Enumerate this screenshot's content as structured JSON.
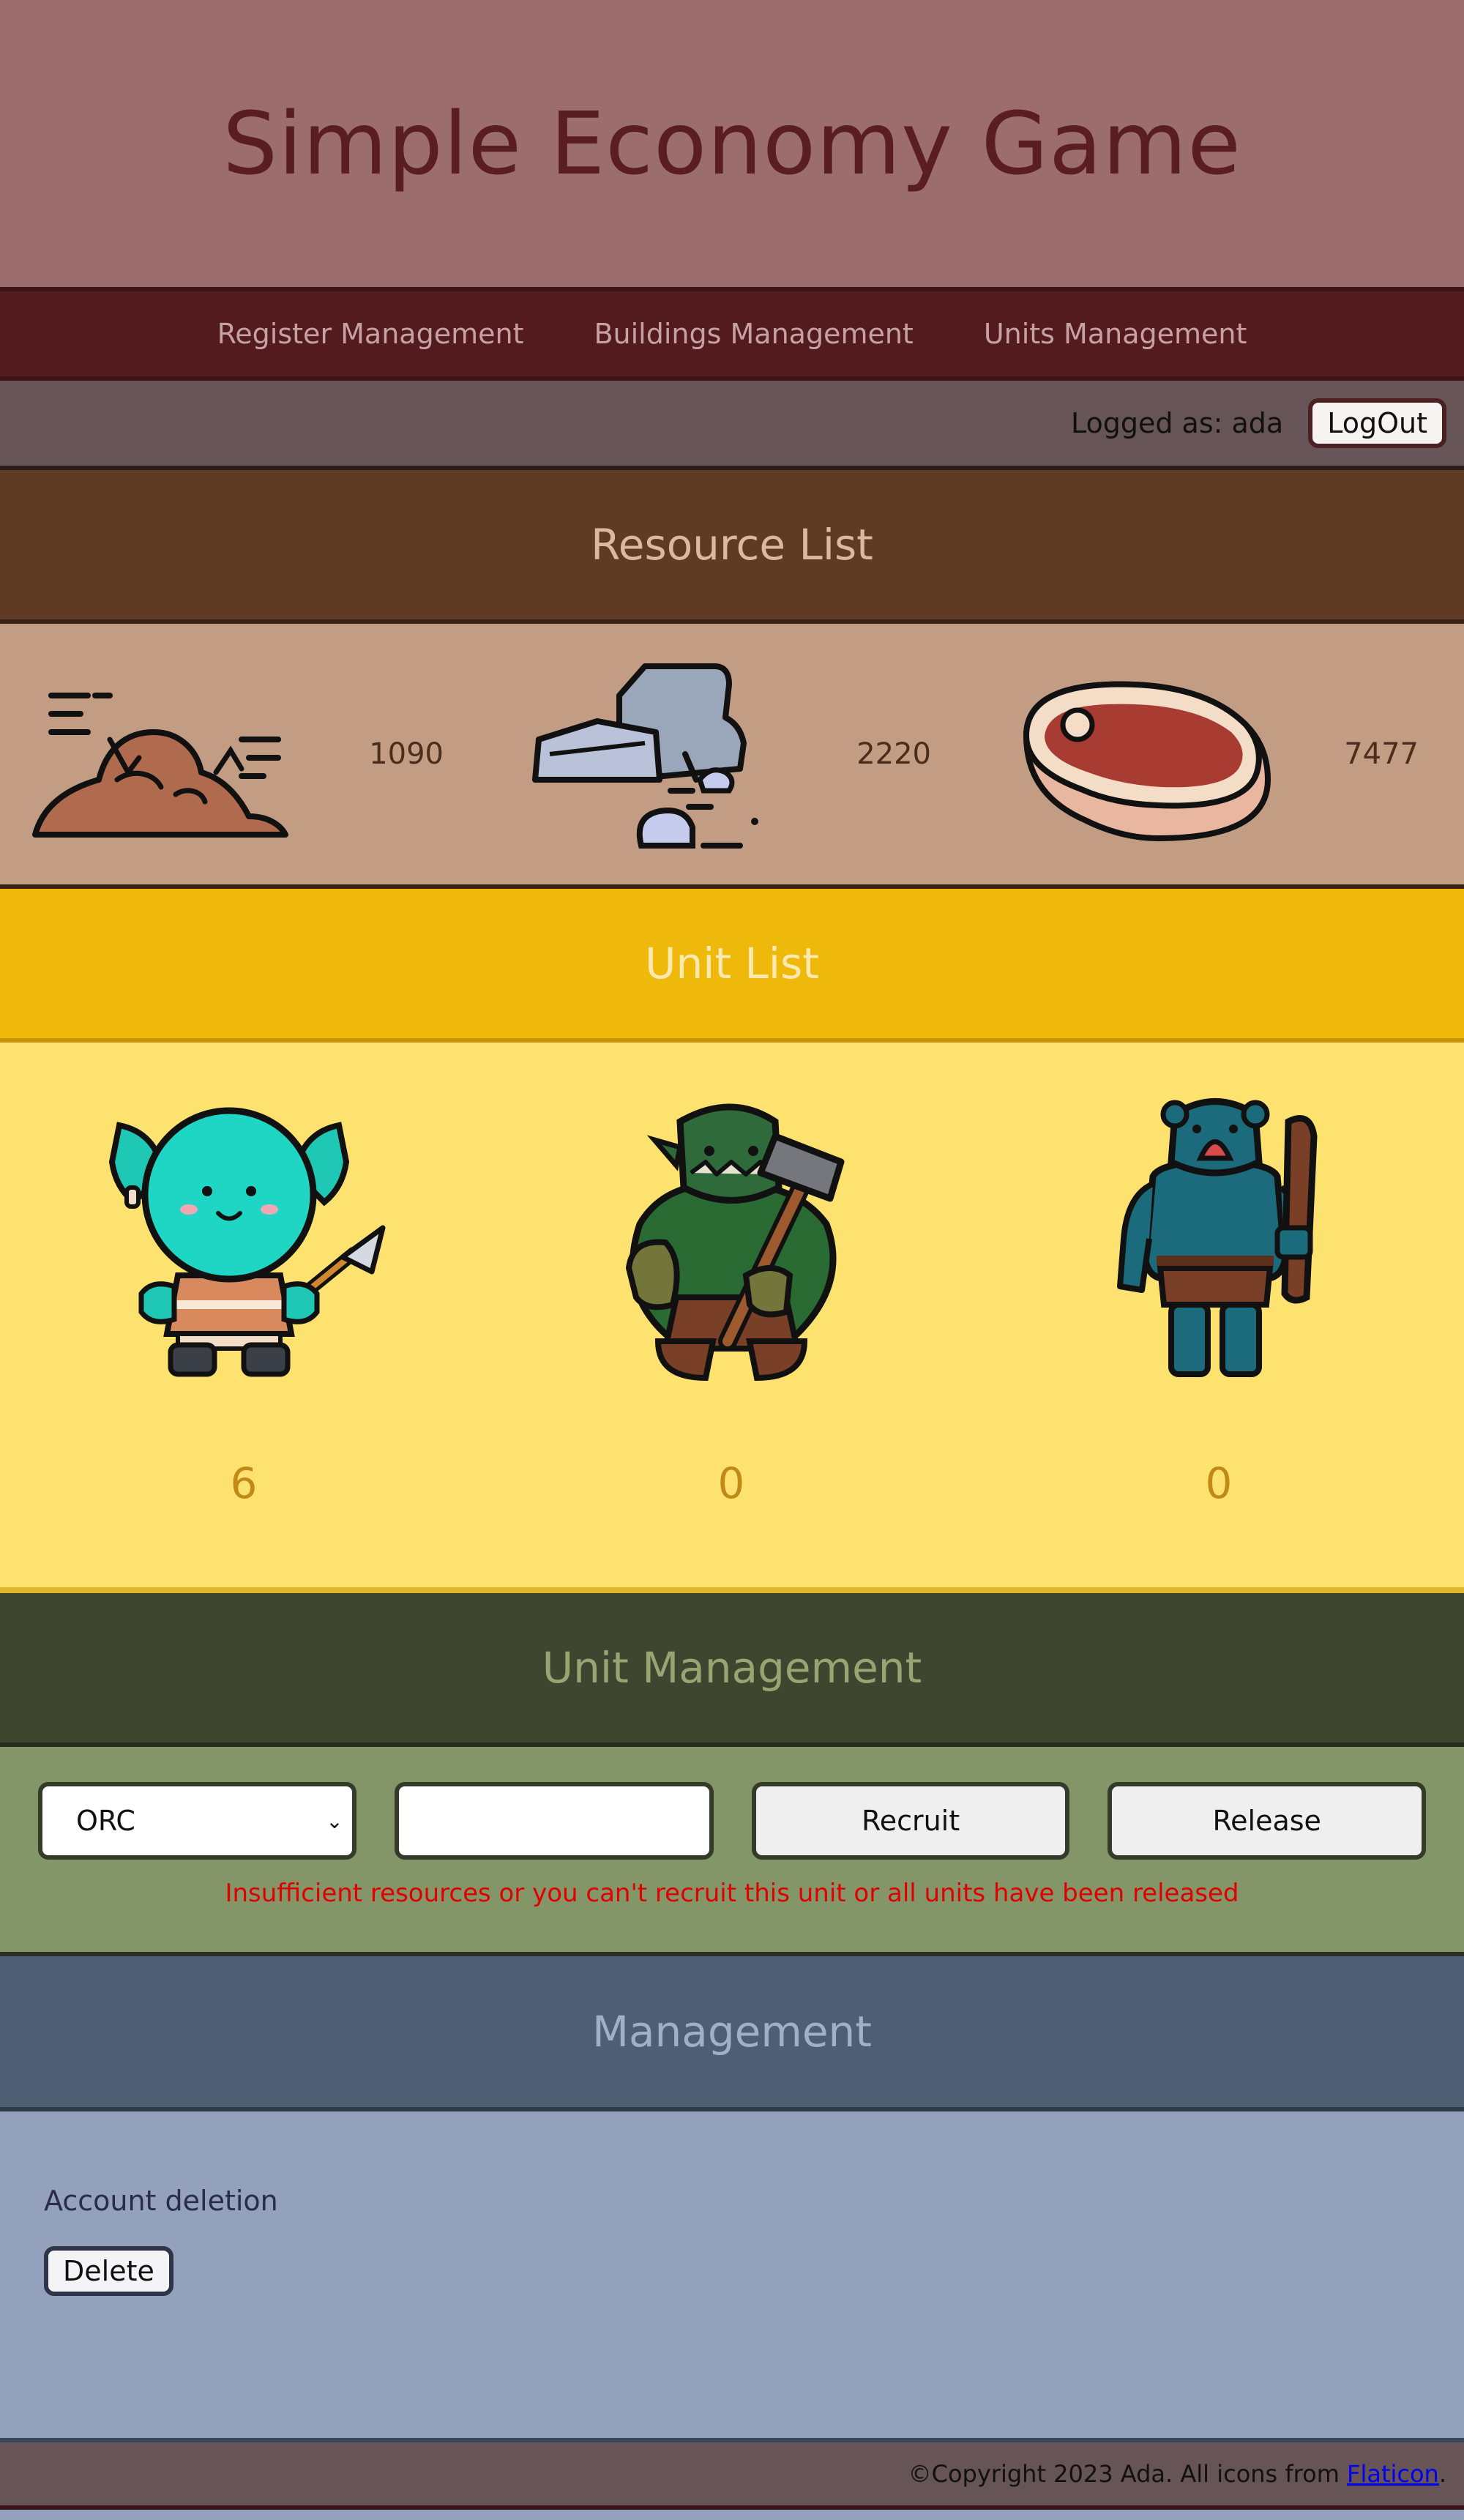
{
  "header": {
    "title": "Simple Economy Game"
  },
  "nav": {
    "items": [
      "Register Management",
      "Buildings Management",
      "Units Management"
    ]
  },
  "user_bar": {
    "logged_as": "Logged as: ada",
    "logout_label": "LogOut"
  },
  "resources": {
    "title": "Resource List",
    "items": [
      {
        "icon": "dirt-pile-icon",
        "value": "1090"
      },
      {
        "icon": "stone-rocks-icon",
        "value": "2220"
      },
      {
        "icon": "meat-steak-icon",
        "value": "7477"
      }
    ]
  },
  "units": {
    "title": "Unit List",
    "items": [
      {
        "icon": "goblin-spearman-icon",
        "count": "6"
      },
      {
        "icon": "orc-hammer-icon",
        "count": "0"
      },
      {
        "icon": "troll-club-icon",
        "count": "0"
      }
    ]
  },
  "unit_management": {
    "title": "Unit Management",
    "select_value": "ORC",
    "quantity_value": "",
    "recruit_label": "Recruit",
    "release_label": "Release",
    "error": "Insufficient resources or you can't recruit this unit or all units have been released"
  },
  "management": {
    "title": "Management",
    "account_deletion_label": "Account deletion",
    "delete_label": "Delete"
  },
  "footer": {
    "copyright": "©Copyright 2023 Ada. All icons from ",
    "link_text": "Flaticon",
    "suffix": "."
  }
}
